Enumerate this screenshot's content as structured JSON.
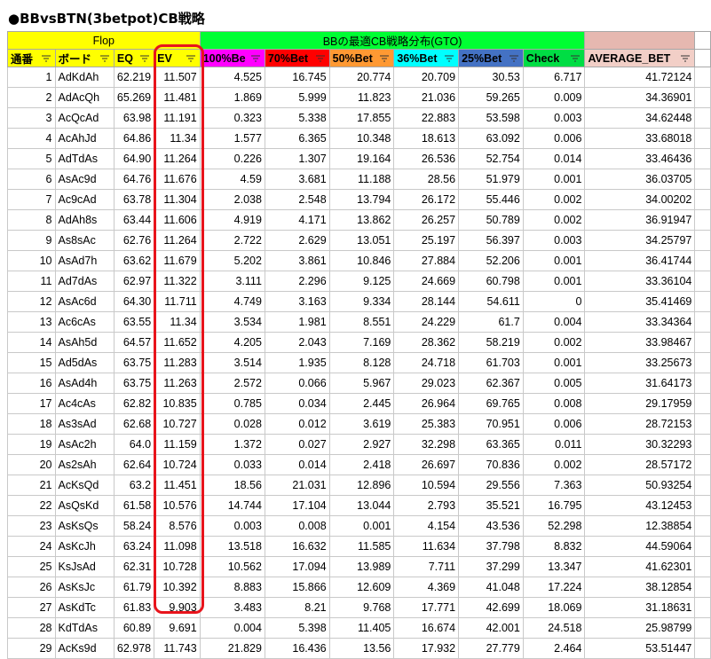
{
  "title": "●BBvsBTN(3betpot)CB戦略",
  "group_headers": {
    "flop": "Flop",
    "strategy": "BBの最適CB戦略分布(GTO)",
    "extra": ""
  },
  "columns": [
    {
      "key": "no",
      "label": "通番",
      "color": "#ffff00"
    },
    {
      "key": "board",
      "label": "ボード",
      "color": "#ffff00"
    },
    {
      "key": "eq",
      "label": "EQ",
      "color": "#ffff00"
    },
    {
      "key": "ev",
      "label": "EV",
      "color": "#ffff00"
    },
    {
      "key": "b100",
      "label": "100%Be",
      "color": "#ff00ff"
    },
    {
      "key": "b70",
      "label": "70%Bet",
      "color": "#ff0000"
    },
    {
      "key": "b50",
      "label": "50%Bet",
      "color": "#ff9933"
    },
    {
      "key": "b36",
      "label": "36%Bet",
      "color": "#00ffff"
    },
    {
      "key": "b25",
      "label": "25%Bet",
      "color": "#4472c4"
    },
    {
      "key": "check",
      "label": "Check",
      "color": "#00dd44"
    },
    {
      "key": "avg",
      "label": "AVERAGE_BET",
      "color": "#f2cfc7"
    }
  ],
  "colors": {
    "flop_group": "#ffff00",
    "strategy_group": "#00ff33",
    "extra_group": "#e6b8b0",
    "highlight": "#e8141c"
  },
  "rows": [
    [
      "1",
      "AdKdAh",
      "62.219",
      "11.507",
      "4.525",
      "16.745",
      "20.774",
      "20.709",
      "30.53",
      "6.717",
      "41.72124"
    ],
    [
      "2",
      "AdAcQh",
      "65.269",
      "11.481",
      "1.869",
      "5.999",
      "11.823",
      "21.036",
      "59.265",
      "0.009",
      "34.36901"
    ],
    [
      "3",
      "AcQcAd",
      "63.98",
      "11.191",
      "0.323",
      "5.338",
      "17.855",
      "22.883",
      "53.598",
      "0.003",
      "34.62448"
    ],
    [
      "4",
      "AcAhJd",
      "64.86",
      "11.34",
      "1.577",
      "6.365",
      "10.348",
      "18.613",
      "63.092",
      "0.006",
      "33.68018"
    ],
    [
      "5",
      "AdTdAs",
      "64.90",
      "11.264",
      "0.226",
      "1.307",
      "19.164",
      "26.536",
      "52.754",
      "0.014",
      "33.46436"
    ],
    [
      "6",
      "AsAc9d",
      "64.76",
      "11.676",
      "4.59",
      "3.681",
      "11.188",
      "28.56",
      "51.979",
      "0.001",
      "36.03705"
    ],
    [
      "7",
      "Ac9cAd",
      "63.78",
      "11.304",
      "2.038",
      "2.548",
      "13.794",
      "26.172",
      "55.446",
      "0.002",
      "34.00202"
    ],
    [
      "8",
      "AdAh8s",
      "63.44",
      "11.606",
      "4.919",
      "4.171",
      "13.862",
      "26.257",
      "50.789",
      "0.002",
      "36.91947"
    ],
    [
      "9",
      "As8sAc",
      "62.76",
      "11.264",
      "2.722",
      "2.629",
      "13.051",
      "25.197",
      "56.397",
      "0.003",
      "34.25797"
    ],
    [
      "10",
      "AsAd7h",
      "63.62",
      "11.679",
      "5.202",
      "3.861",
      "10.846",
      "27.884",
      "52.206",
      "0.001",
      "36.41744"
    ],
    [
      "11",
      "Ad7dAs",
      "62.97",
      "11.322",
      "3.111",
      "2.296",
      "9.125",
      "24.669",
      "60.798",
      "0.001",
      "33.36104"
    ],
    [
      "12",
      "AsAc6d",
      "64.30",
      "11.711",
      "4.749",
      "3.163",
      "9.334",
      "28.144",
      "54.611",
      "0",
      "35.41469"
    ],
    [
      "13",
      "Ac6cAs",
      "63.55",
      "11.34",
      "3.534",
      "1.981",
      "8.551",
      "24.229",
      "61.7",
      "0.004",
      "33.34364"
    ],
    [
      "14",
      "AsAh5d",
      "64.57",
      "11.652",
      "4.205",
      "2.043",
      "7.169",
      "28.362",
      "58.219",
      "0.002",
      "33.98467"
    ],
    [
      "15",
      "Ad5dAs",
      "63.75",
      "11.283",
      "3.514",
      "1.935",
      "8.128",
      "24.718",
      "61.703",
      "0.001",
      "33.25673"
    ],
    [
      "16",
      "AsAd4h",
      "63.75",
      "11.263",
      "2.572",
      "0.066",
      "5.967",
      "29.023",
      "62.367",
      "0.005",
      "31.64173"
    ],
    [
      "17",
      "Ac4cAs",
      "62.82",
      "10.835",
      "0.785",
      "0.034",
      "2.445",
      "26.964",
      "69.765",
      "0.008",
      "29.17959"
    ],
    [
      "18",
      "As3sAd",
      "62.68",
      "10.727",
      "0.028",
      "0.012",
      "3.619",
      "25.383",
      "70.951",
      "0.006",
      "28.72153"
    ],
    [
      "19",
      "AsAc2h",
      "64.0",
      "11.159",
      "1.372",
      "0.027",
      "2.927",
      "32.298",
      "63.365",
      "0.011",
      "30.32293"
    ],
    [
      "20",
      "As2sAh",
      "62.64",
      "10.724",
      "0.033",
      "0.014",
      "2.418",
      "26.697",
      "70.836",
      "0.002",
      "28.57172"
    ],
    [
      "21",
      "AcKsQd",
      "63.2",
      "11.451",
      "18.56",
      "21.031",
      "12.896",
      "10.594",
      "29.556",
      "7.363",
      "50.93254"
    ],
    [
      "22",
      "AsQsKd",
      "61.58",
      "10.576",
      "14.744",
      "17.104",
      "13.044",
      "2.793",
      "35.521",
      "16.795",
      "43.12453"
    ],
    [
      "23",
      "AsKsQs",
      "58.24",
      "8.576",
      "0.003",
      "0.008",
      "0.001",
      "4.154",
      "43.536",
      "52.298",
      "12.38854"
    ],
    [
      "24",
      "AsKcJh",
      "63.24",
      "11.098",
      "13.518",
      "16.632",
      "11.585",
      "11.634",
      "37.798",
      "8.832",
      "44.59064"
    ],
    [
      "25",
      "KsJsAd",
      "62.31",
      "10.728",
      "10.562",
      "17.094",
      "13.989",
      "7.711",
      "37.299",
      "13.347",
      "41.62301"
    ],
    [
      "26",
      "AsKsJc",
      "61.79",
      "10.392",
      "8.883",
      "15.866",
      "12.609",
      "4.369",
      "41.048",
      "17.224",
      "38.12854"
    ],
    [
      "27",
      "AsKdTc",
      "61.83",
      "9.903",
      "3.483",
      "8.21",
      "9.768",
      "17.771",
      "42.699",
      "18.069",
      "31.18631"
    ],
    [
      "28",
      "KdTdAs",
      "60.89",
      "9.691",
      "0.004",
      "5.398",
      "11.405",
      "16.674",
      "42.001",
      "24.518",
      "25.98799"
    ],
    [
      "29",
      "AcKs9d",
      "62.978",
      "11.743",
      "21.829",
      "16.436",
      "13.56",
      "17.932",
      "27.779",
      "2.464",
      "53.51447"
    ]
  ]
}
